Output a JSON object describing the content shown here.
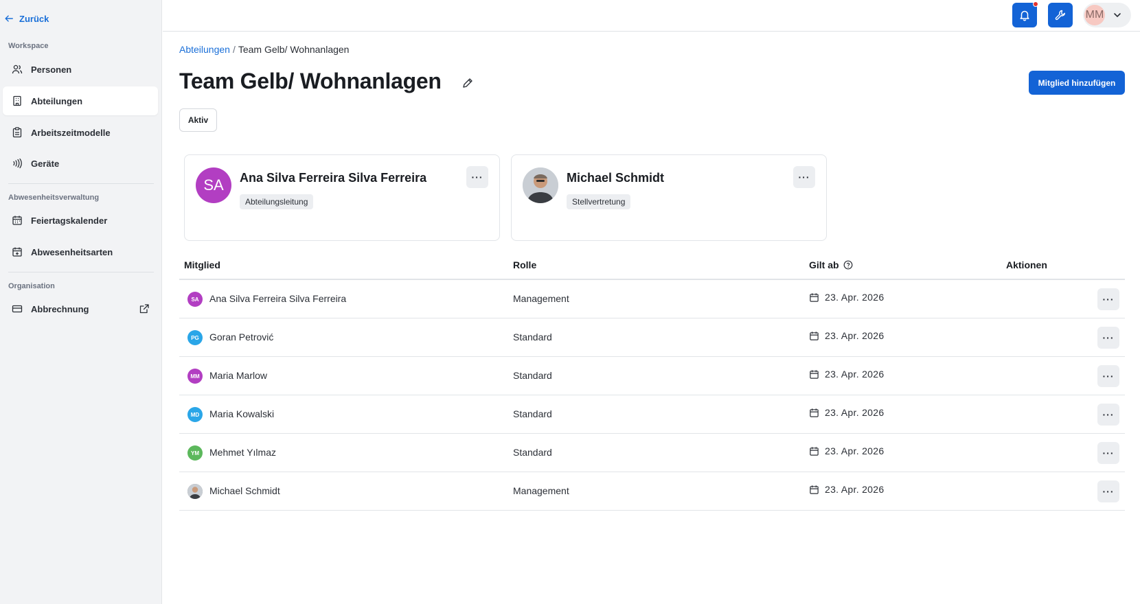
{
  "sidebar": {
    "back_label": "Zurück",
    "sections": [
      {
        "label": "Workspace"
      },
      {
        "label": "Abwesenheitsverwaltung"
      },
      {
        "label": "Organisation"
      }
    ],
    "items": [
      {
        "label": "Personen",
        "icon": "users-icon"
      },
      {
        "label": "Abteilungen",
        "icon": "building-icon",
        "active": true
      },
      {
        "label": "Arbeitszeitmodelle",
        "icon": "clipboard-icon"
      },
      {
        "label": "Geräte",
        "icon": "nfc-icon"
      },
      {
        "label": "Feiertagskalender",
        "icon": "calendar-icon"
      },
      {
        "label": "Abwesenheitsarten",
        "icon": "calendar-plus-icon"
      },
      {
        "label": "Abbrechnung",
        "icon": "credit-card-icon"
      }
    ]
  },
  "topbar": {
    "user_initials": "MM",
    "accent": "#1363d6",
    "notification_dot": "#e5322d"
  },
  "breadcrumb": {
    "parent": "Abteilungen",
    "separator": "/",
    "current": "Team Gelb/ Wohnanlagen"
  },
  "page": {
    "title": "Team Gelb/ Wohnanlagen",
    "status": "Aktiv",
    "add_member_label": "Mitglied hinzufügen"
  },
  "leaders": [
    {
      "initials": "SA",
      "name": "Ana Silva Ferreira Silva Ferreira",
      "role": "Abteilungsleitung",
      "color": "#b23ec2",
      "more": "···"
    },
    {
      "initials": "",
      "name": "Michael Schmidt",
      "role": "Stellvertretung",
      "color": "#6b6b6b",
      "more": "···"
    }
  ],
  "table": {
    "columns": [
      "Mitglied",
      "Rolle",
      "Gilt ab",
      "Aktionen"
    ],
    "rows": [
      {
        "initials": "SA",
        "color": "#b23ec2",
        "name": "Ana Silva Ferreira Silva Ferreira",
        "role": "Management",
        "date": "23. Apr. 2026",
        "more": "···"
      },
      {
        "initials": "PG",
        "color": "#2aa6e8",
        "name": "Goran Petrović",
        "role": "Standard",
        "date": "23. Apr. 2026",
        "more": "···"
      },
      {
        "initials": "MM",
        "color": "#b23ec2",
        "name": "Maria Marlow",
        "role": "Standard",
        "date": "23. Apr. 2026",
        "more": "···"
      },
      {
        "initials": "MD",
        "color": "#2aa6e8",
        "name": "Maria Kowalski",
        "role": "Standard",
        "date": "23. Apr. 2026",
        "more": "···"
      },
      {
        "initials": "YM",
        "color": "#5cb85c",
        "name": "Mehmet Yılmaz",
        "role": "Standard",
        "date": "23. Apr. 2026",
        "more": "···"
      },
      {
        "initials": "",
        "color": "#6b6b6b",
        "name": "Michael Schmidt",
        "role": "Management",
        "date": "23. Apr. 2026",
        "more": "···"
      }
    ]
  }
}
